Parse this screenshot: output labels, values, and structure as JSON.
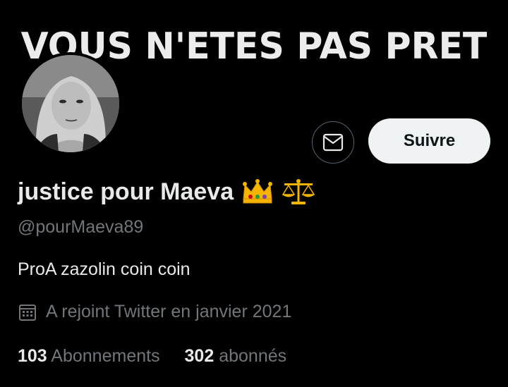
{
  "banner": {
    "text": "VOUS N'ETES PAS PRET"
  },
  "profile": {
    "display_name": "justice pour Maeva",
    "name_emojis": [
      "crown-icon",
      "scales-icon"
    ],
    "handle": "@pourMaeva89",
    "bio": "ProA zazolin coin coin",
    "joined": "A rejoint Twitter en janvier 2021"
  },
  "actions": {
    "message_icon": "envelope-icon",
    "follow_label": "Suivre"
  },
  "stats": {
    "following_count": "103",
    "following_label": "Abonnements",
    "followers_count": "302",
    "followers_label": "abonnés"
  },
  "colors": {
    "background": "#000000",
    "primary_text": "#e7e9ea",
    "secondary_text": "#71767b",
    "follow_button_bg": "#eff3f4",
    "follow_button_text": "#0f1419",
    "border": "#536471"
  }
}
